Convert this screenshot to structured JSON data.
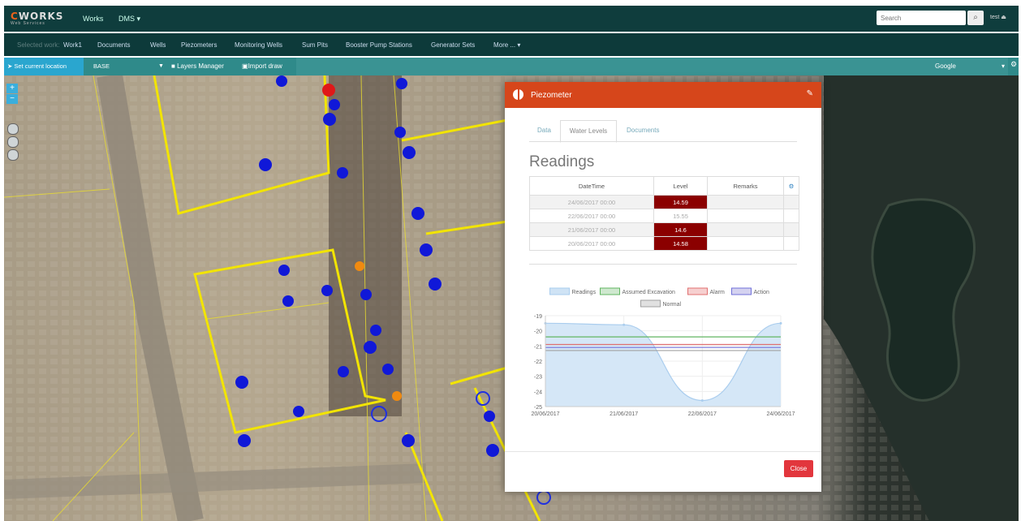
{
  "app": {
    "logo_main": "CWORKS",
    "logo_sub": "Web Services",
    "nav": {
      "works": "Works",
      "dms": "DMS ▾"
    },
    "search_placeholder": "Search",
    "user": "test"
  },
  "subnav": {
    "selected_prefix": "Selected work:",
    "selected_work": "Work1",
    "items": [
      "Documents",
      "Wells",
      "Piezometers",
      "Monitoring Wells",
      "Sum Pits",
      "Booster Pump Stations",
      "Generator Sets",
      "More ... ▾"
    ]
  },
  "map_toolbar": {
    "set_location": "Set current location",
    "base_layer": "BASE",
    "layers_manager": "Layers Manager",
    "import_draw": "Import draw",
    "provider": "Google"
  },
  "modal": {
    "title": "Piezometer",
    "tabs": [
      "Data",
      "Water Levels",
      "Documents"
    ],
    "active_tab": "Water Levels",
    "heading": "Readings",
    "columns": [
      "DateTime",
      "Level",
      "Remarks"
    ],
    "rows": [
      {
        "datetime": "24/06/2017 00:00",
        "level": "14.59",
        "highlight": true
      },
      {
        "datetime": "22/06/2017 00:00",
        "level": "15.55",
        "highlight": false
      },
      {
        "datetime": "21/06/2017 00:00",
        "level": "14.6",
        "highlight": true
      },
      {
        "datetime": "20/06/2017 00:00",
        "level": "14.58",
        "highlight": true
      }
    ],
    "close_label": "Close"
  },
  "chart_data": {
    "type": "line",
    "legend": [
      {
        "name": "Readings",
        "color": "#cfe3f5"
      },
      {
        "name": "Assumed Excavation",
        "color": "#cfe8cf"
      },
      {
        "name": "Alarm",
        "color": "#f6cfcf"
      },
      {
        "name": "Action",
        "color": "#d4d2f0"
      },
      {
        "name": "Normal",
        "color": "#e0e0e0"
      }
    ],
    "x_labels": [
      "20/06/2017",
      "21/06/2017",
      "22/06/2017",
      "24/06/2017"
    ],
    "y_ticks": [
      -19,
      -20,
      -21,
      -22,
      -23,
      -24,
      -25
    ],
    "ylim": [
      -25,
      -19
    ],
    "series": [
      {
        "name": "Readings",
        "values": [
          -19.5,
          -19.6,
          -24.6,
          -19.5
        ],
        "color": "#aacdee"
      },
      {
        "name": "Assumed Excavation",
        "values": [
          -20.4,
          -20.4,
          -20.4,
          -20.4
        ],
        "color": "#62b662"
      },
      {
        "name": "Alarm",
        "values": [
          -20.9,
          -20.9,
          -20.9,
          -20.9
        ],
        "color": "#e07070"
      },
      {
        "name": "Action",
        "values": [
          -21.1,
          -21.1,
          -21.1,
          -21.1
        ],
        "color": "#7070d8"
      },
      {
        "name": "Normal",
        "values": [
          -21.3,
          -21.3,
          -21.3,
          -21.3
        ],
        "color": "#a0a0a0"
      }
    ]
  }
}
